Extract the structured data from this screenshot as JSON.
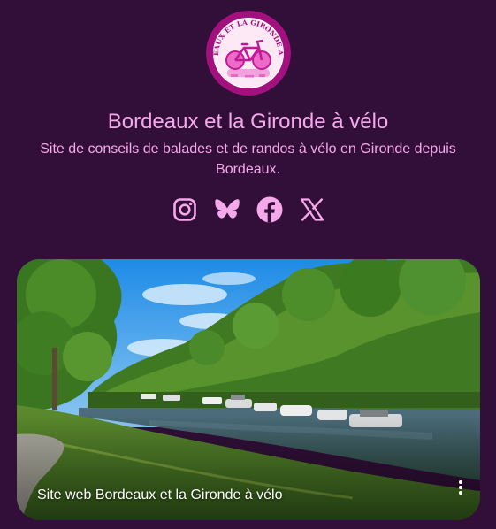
{
  "profile": {
    "logo_text": "BORDEAUX ET LA GIRONDE À VÉLO",
    "title": "Bordeaux et la Gironde à vélo",
    "description": "Site de conseils de balades et de randos à vélo en Gironde depuis Bordeaux."
  },
  "socials": [
    {
      "icon": "instagram-icon"
    },
    {
      "icon": "bluesky-icon"
    },
    {
      "icon": "facebook-icon"
    },
    {
      "icon": "x-icon"
    }
  ],
  "link_card": {
    "label": "Site web Bordeaux et la Gironde à vélo"
  },
  "colors": {
    "background": "#310f38",
    "text": "#f6a9ea",
    "logo_ring": "#a3117f",
    "logo_pink": "#e865c8"
  }
}
